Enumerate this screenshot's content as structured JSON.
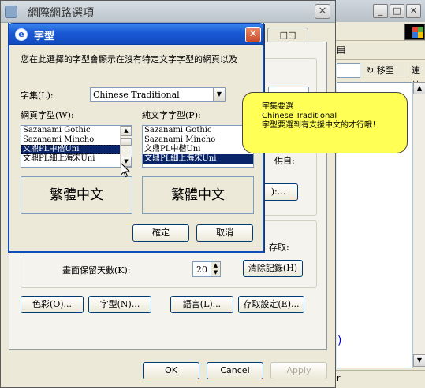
{
  "browser": {
    "go_label": "移至",
    "links_label": "連結",
    "status_text": "r",
    "content_link": ")"
  },
  "options_dialog": {
    "title": "網際網路選項",
    "tab_partial": "□□",
    "peek_text_1": "供自:",
    "peek_text_2": "):...",
    "history": {
      "peek_text": "存取:",
      "days_label": "畫面保留天數(K):",
      "days_value": "20",
      "clear_button": "清除記錄(H)"
    },
    "bottom_buttons": {
      "colors": "色彩(O)...",
      "fonts": "字型(N)...",
      "languages": "語言(L)...",
      "accessibility": "存取設定(E)..."
    },
    "ok": "OK",
    "cancel": "Cancel",
    "apply": "Apply"
  },
  "font_dialog": {
    "title": "字型",
    "description": "您在此選擇的字型會顯示在沒有特定文字字型的網頁以及",
    "charset_label": "字集(L):",
    "charset_value": "Chinese Traditional",
    "web_font_label": "網頁字型(W):",
    "plain_font_label": "純文字字型(P):",
    "web_fonts": [
      "Sazanami Gothic",
      "Sazanami Mincho",
      "文鼎PL中楷Uni",
      "文鼎PL細上海宋Uni"
    ],
    "web_fonts_selected": "文鼎PL中楷Uni",
    "plain_fonts": [
      "Sazanami Gothic",
      "Sazanami Mincho",
      "文鼎PL中楷Uni",
      "文鼎PL細上海宋Uni"
    ],
    "plain_fonts_selected": "文鼎PL細上海宋Uni",
    "web_preview": "繁體中文",
    "plain_preview": "繁體中文",
    "ok": "確定",
    "cancel": "取消"
  },
  "tooltip": {
    "line1": "字集要選",
    "line2": "Chinese Traditional",
    "line3": "字型要選到有支援中文的才行哦！"
  },
  "colors": {
    "titlebar_active": "#1959d4",
    "selection": "#0a246a",
    "tooltip_bg": "#ffff55"
  }
}
